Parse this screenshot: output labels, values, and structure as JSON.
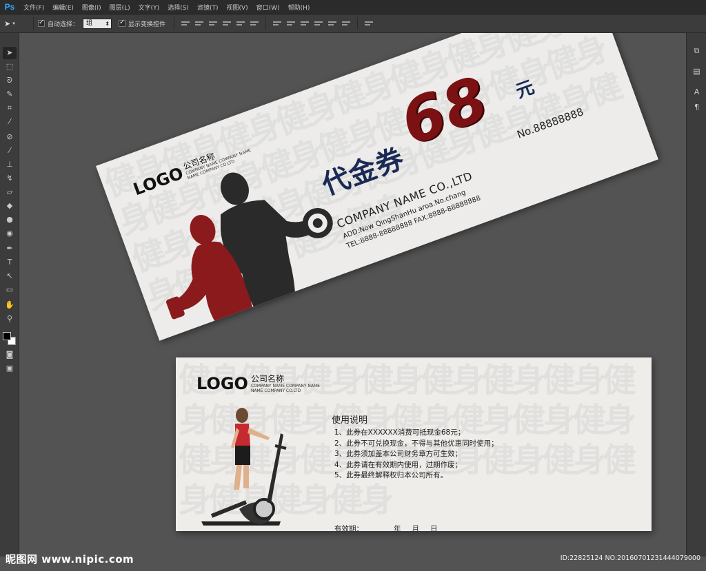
{
  "app": {
    "logo": "Ps"
  },
  "menu": [
    "文件(F)",
    "编辑(E)",
    "图像(I)",
    "图层(L)",
    "文字(Y)",
    "选择(S)",
    "滤镜(T)",
    "视图(V)",
    "窗口(W)",
    "帮助(H)"
  ],
  "options": {
    "auto_select_label": "自动选择：",
    "auto_select_value": "组",
    "show_transform_label": "显示变换控件"
  },
  "front": {
    "logo_word": "LOGO",
    "company_cn": "公司名称",
    "company_en_1": "COMPANY NAME COMPANY NAME",
    "company_en_2": "NAME COMPANY CO.LTD",
    "title": "代金券",
    "amount": "68",
    "unit": "元",
    "serial": "No.88888888",
    "company_en": "COMPANY NAME CO.,LTD",
    "address": "ADD:Now QingShanHu aroa.No.chang",
    "tel_fax": "TEL:8888-88888888  FAX:8888-88888888",
    "watermark_text": "健身健身健身健身健身健身健身健身健身健身健身健身健身健身健身健身健身健身健身健身健身健身健身健身健身健身健身健身健身健身"
  },
  "back": {
    "logo_word": "LOGO",
    "company_cn": "公司名称",
    "company_en_1": "COMPANY NAME COMPANY NAME",
    "company_en_2": "NAME COMPANY CO.LTD",
    "usage_title": "使用说明",
    "rules": [
      "1、此券在XXXXXX消费可抵现金68元；",
      "2、此券不可兑换现金，不得与其他优惠同时使用；",
      "3、此券须加盖本公司财务章方可生效；",
      "4、此券请在有效期内使用，过期作废；",
      "5、此券最终解释权归本公司所有。"
    ],
    "validity_label": "有效期：",
    "year": "年",
    "month": "月",
    "day": "日",
    "watermark_text": "健身健身健身健身健身健身健身健身健身健身健身健身健身健身健身健身健身健身健身健身健身健身健身健身健身健身"
  },
  "footer": {
    "site": "昵图网 www.nipic.com",
    "id_text": "ID:22825124 NO:20160701231444079000"
  },
  "colors": {
    "accent_red": "#7b1113",
    "navy": "#1a2a55",
    "ps_blue": "#31a8ff"
  }
}
